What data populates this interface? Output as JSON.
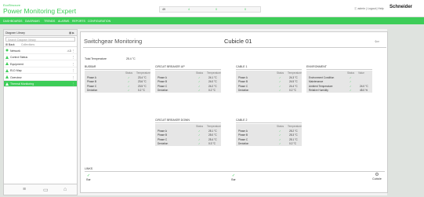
{
  "app": {
    "brand_sub": "EcoStruxure",
    "title": "Power Monitoring Expert"
  },
  "alarms": {
    "c0": "49",
    "c1": "4",
    "c2": "0",
    "c3": "0"
  },
  "user_area": "Ⓘ admin | Logout | Help",
  "logo": "Schneider",
  "nav": {
    "items": [
      "DASHBOARDS",
      "DIAGRAMS",
      "TRENDS",
      "ALARMS",
      "REPORTS",
      "CONFIGURATION"
    ]
  },
  "sidebar": {
    "header": "Diagram Library",
    "search_placeholder": "Search Diagram library",
    "sub_left": "⊞ Back",
    "sub_right": "Collections",
    "items": [
      {
        "label": "Network",
        "count": "⚠3 ⋮",
        "icon_color": "#3dcd58"
      },
      {
        "label": "Control Status",
        "count": "⋮",
        "icon_color": "#3dcd58"
      },
      {
        "label": "Equipment",
        "count": "⋮",
        "icon_color": "#3dcd58"
      },
      {
        "label": "ELD Map",
        "count": "⋮",
        "icon_color": "#3dcd58"
      },
      {
        "label": "Overview",
        "count": "⋮",
        "icon_color": "#3dcd58"
      },
      {
        "label": "Thermal Monitoring",
        "count": "⋮",
        "icon_color": "#ffffff"
      }
    ],
    "footer": {
      "home": "⌂",
      "a": "≡",
      "b": "⌂"
    }
  },
  "main": {
    "title": "Switchgear Monitoring",
    "cubicle": "Cubicle 01",
    "share_icon": "⇦",
    "total_temp_label": "Total Temperature",
    "total_temp_value": "25.4 °C",
    "panels": [
      {
        "title": "BUSBAR",
        "headers": {
          "status": "Status",
          "temp": "Temperature"
        },
        "rows": [
          {
            "label": "Phase A",
            "status": "✓",
            "temp": "23.4 °C"
          },
          {
            "label": "Phase B",
            "status": "✓",
            "temp": "23.6 °C"
          },
          {
            "label": "Phase C",
            "status": "✓",
            "temp": "23.5 °C"
          },
          {
            "label": "Deviation",
            "status": "✓",
            "temp": "0.2 °C"
          }
        ]
      },
      {
        "title": "CIRCUIT BREAKER UP",
        "headers": {
          "status": "Status",
          "temp": "Temperature"
        },
        "rows": [
          {
            "label": "Phase A",
            "status": "✓",
            "temp": "24.1 °C"
          },
          {
            "label": "Phase B",
            "status": "✓",
            "temp": "24.0 °C"
          },
          {
            "label": "Phase C",
            "status": "✓",
            "temp": "24.2 °C"
          },
          {
            "label": "Deviation",
            "status": "✓",
            "temp": "0.2 °C"
          }
        ]
      },
      {
        "title": "CABLE 1",
        "headers": {
          "status": "Status",
          "temp": "Temperature"
        },
        "rows": [
          {
            "label": "Phase A",
            "status": "✓",
            "temp": "24.3 °C"
          },
          {
            "label": "Phase B",
            "status": "✓",
            "temp": "24.5 °C"
          },
          {
            "label": "Phase C",
            "status": "✓",
            "temp": "24.4 °C"
          },
          {
            "label": "Deviation",
            "status": "✓",
            "temp": "0.2 °C"
          }
        ]
      },
      {
        "title": "ENVIRONMENT",
        "headers": {
          "status": "Status",
          "temp": "Value"
        },
        "rows": [
          {
            "label": "Environment Condition",
            "status": "✓",
            "temp": ""
          },
          {
            "label": "Maintenance",
            "status": "✓",
            "temp": ""
          },
          {
            "label": "Ambient Temperature",
            "status": "✓",
            "temp": "24.0 °C"
          },
          {
            "label": "Relative Humidity",
            "status": "✓",
            "temp": "45.0 %"
          }
        ]
      },
      {
        "title": "CIRCUIT BREAKER DOWN",
        "headers": {
          "status": "Status",
          "temp": "Temperature"
        },
        "rows": [
          {
            "label": "Phase A",
            "status": "✓",
            "temp": "25.1 °C"
          },
          {
            "label": "Phase B",
            "status": "✓",
            "temp": "25.0 °C"
          },
          {
            "label": "Phase C",
            "status": "✓",
            "temp": "25.4 °C"
          },
          {
            "label": "Deviation",
            "status": "✓",
            "temp": "0.3 °C"
          }
        ]
      },
      {
        "title": "CABLE 2",
        "headers": {
          "status": "Status",
          "temp": "Temperature"
        },
        "rows": [
          {
            "label": "Phase A",
            "status": "✓",
            "temp": "25.2 °C"
          },
          {
            "label": "Phase B",
            "status": "✓",
            "temp": "25.3 °C"
          },
          {
            "label": "Phase C",
            "status": "✓",
            "temp": "25.1 °C"
          },
          {
            "label": "Deviation",
            "status": "✓",
            "temp": "0.2 °C"
          }
        ]
      }
    ],
    "links_title": "LINKS",
    "links": [
      {
        "label": "Bar",
        "icon": "✓"
      },
      {
        "label": "Bar",
        "icon": "✓"
      },
      {
        "label": "Cubicle",
        "icon": "⚙"
      }
    ]
  },
  "colors": {
    "accent": "#3dcd58",
    "ok": "#3dcd58"
  }
}
